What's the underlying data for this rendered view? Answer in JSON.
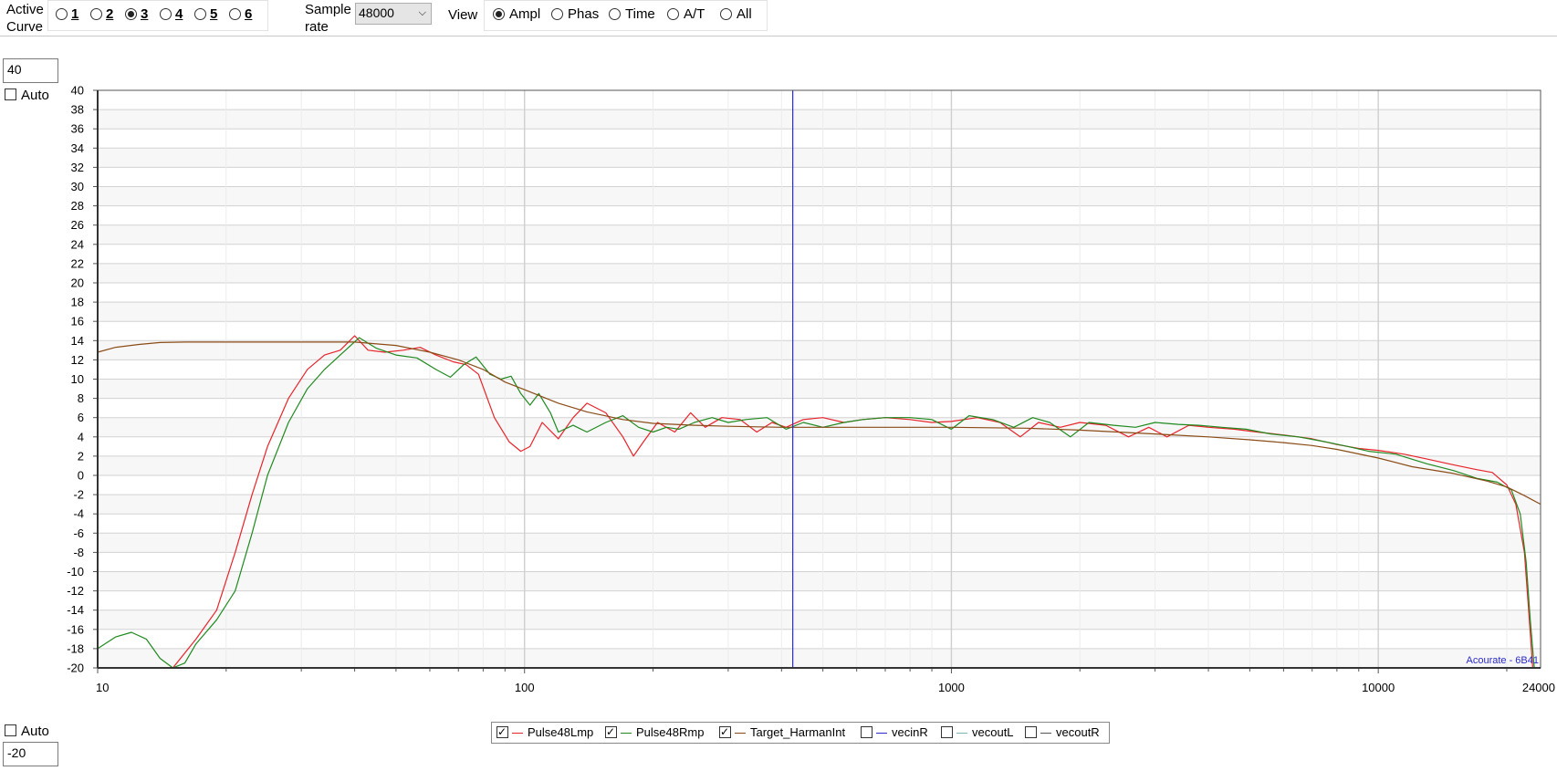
{
  "toolbar": {
    "active_curve_label": [
      "Active",
      "Curve"
    ],
    "curves": [
      {
        "label": "1",
        "selected": false
      },
      {
        "label": "2",
        "selected": false
      },
      {
        "label": "3",
        "selected": true
      },
      {
        "label": "4",
        "selected": false
      },
      {
        "label": "5",
        "selected": false
      },
      {
        "label": "6",
        "selected": false
      }
    ],
    "sample_rate_label": [
      "Sample",
      "rate"
    ],
    "sample_rate_value": "48000",
    "view_label": "View",
    "views": [
      {
        "label": "Ampl",
        "selected": true
      },
      {
        "label": "Phas",
        "selected": false
      },
      {
        "label": "Time",
        "selected": false
      },
      {
        "label": "A/T",
        "selected": false
      },
      {
        "label": "All",
        "selected": false
      }
    ]
  },
  "ymax_input": "40",
  "ymin_input": "-20",
  "auto_top_label": "Auto",
  "auto_bottom_label": "Auto",
  "auto_top_checked": false,
  "auto_bottom_checked": false,
  "watermark": "Acourate - 6B41",
  "colors": {
    "red": "#e8232a",
    "green": "#1f8a1f",
    "brown": "#8a4b16",
    "marker": "#2a2acc",
    "grid": "#d2d2d2"
  },
  "chart_data": {
    "type": "line",
    "x_scale": "log",
    "xlim": [
      10,
      24000
    ],
    "ylim": [
      -20,
      40
    ],
    "x_tick_labels": [
      "10",
      "100",
      "1000",
      "10000",
      "24000"
    ],
    "y_tick_labels": [
      "40",
      "38",
      "36",
      "34",
      "32",
      "30",
      "28",
      "26",
      "24",
      "22",
      "20",
      "18",
      "16",
      "14",
      "12",
      "10",
      "8",
      "6",
      "4",
      "2",
      "0",
      "-2",
      "-4",
      "-6",
      "-8",
      "-10",
      "-12",
      "-14",
      "-16",
      "-18",
      "-20"
    ],
    "marker_x": 425,
    "series": [
      {
        "name": "Pulse48Lmp",
        "color": "#e8232a",
        "checked": true,
        "points": [
          [
            15,
            -20
          ],
          [
            17,
            -17
          ],
          [
            19,
            -14
          ],
          [
            21,
            -8
          ],
          [
            23,
            -2
          ],
          [
            25,
            3
          ],
          [
            28,
            8
          ],
          [
            31,
            11
          ],
          [
            34,
            12.5
          ],
          [
            37,
            13
          ],
          [
            40,
            14.5
          ],
          [
            43,
            13
          ],
          [
            47,
            12.8
          ],
          [
            52,
            13
          ],
          [
            57,
            13.3
          ],
          [
            62,
            12.5
          ],
          [
            68,
            11.8
          ],
          [
            73,
            11.5
          ],
          [
            78,
            10.5
          ],
          [
            85,
            6
          ],
          [
            92,
            3.5
          ],
          [
            98,
            2.5
          ],
          [
            103,
            3
          ],
          [
            110,
            5.5
          ],
          [
            120,
            3.8
          ],
          [
            130,
            6
          ],
          [
            140,
            7.5
          ],
          [
            155,
            6.5
          ],
          [
            170,
            4
          ],
          [
            180,
            2
          ],
          [
            190,
            3.5
          ],
          [
            205,
            5.5
          ],
          [
            225,
            4.5
          ],
          [
            245,
            6.5
          ],
          [
            265,
            5
          ],
          [
            290,
            6
          ],
          [
            320,
            5.8
          ],
          [
            350,
            4.5
          ],
          [
            380,
            5.5
          ],
          [
            410,
            5
          ],
          [
            450,
            5.8
          ],
          [
            500,
            6
          ],
          [
            560,
            5.5
          ],
          [
            620,
            5.8
          ],
          [
            700,
            6
          ],
          [
            800,
            5.8
          ],
          [
            900,
            5.5
          ],
          [
            1000,
            5.6
          ],
          [
            1150,
            6
          ],
          [
            1300,
            5.5
          ],
          [
            1450,
            4
          ],
          [
            1600,
            5.5
          ],
          [
            1800,
            5
          ],
          [
            2000,
            5.5
          ],
          [
            2300,
            5.2
          ],
          [
            2600,
            4
          ],
          [
            2900,
            5
          ],
          [
            3200,
            4
          ],
          [
            3600,
            5.2
          ],
          [
            4000,
            5
          ],
          [
            4600,
            4.8
          ],
          [
            5200,
            4.5
          ],
          [
            6000,
            4.2
          ],
          [
            7000,
            3.8
          ],
          [
            8000,
            3.2
          ],
          [
            9000,
            2.8
          ],
          [
            10000,
            2.6
          ],
          [
            11500,
            2.2
          ],
          [
            13000,
            1.7
          ],
          [
            15000,
            1.1
          ],
          [
            17000,
            0.6
          ],
          [
            18500,
            0.3
          ],
          [
            20000,
            -1
          ],
          [
            21000,
            -3
          ],
          [
            22000,
            -8
          ],
          [
            22500,
            -14
          ],
          [
            23000,
            -20
          ]
        ]
      },
      {
        "name": "Pulse48Rmp",
        "color": "#1f8a1f",
        "checked": true,
        "points": [
          [
            10,
            -18
          ],
          [
            11,
            -16.8
          ],
          [
            12,
            -16.3
          ],
          [
            13,
            -17
          ],
          [
            14,
            -19
          ],
          [
            15,
            -20
          ],
          [
            16,
            -19.5
          ],
          [
            17,
            -17.5
          ],
          [
            19,
            -15
          ],
          [
            21,
            -12
          ],
          [
            23,
            -6
          ],
          [
            25,
            0
          ],
          [
            28,
            5.5
          ],
          [
            31,
            9
          ],
          [
            34,
            11
          ],
          [
            37,
            12.5
          ],
          [
            41,
            14.3
          ],
          [
            45,
            13.2
          ],
          [
            50,
            12.5
          ],
          [
            56,
            12.2
          ],
          [
            62,
            11
          ],
          [
            67,
            10.2
          ],
          [
            72,
            11.5
          ],
          [
            77,
            12.3
          ],
          [
            83,
            10.5
          ],
          [
            88,
            10
          ],
          [
            93,
            10.3
          ],
          [
            98,
            8.5
          ],
          [
            103,
            7.3
          ],
          [
            108,
            8.5
          ],
          [
            115,
            6.5
          ],
          [
            120,
            4.5
          ],
          [
            130,
            5.2
          ],
          [
            140,
            4.5
          ],
          [
            155,
            5.5
          ],
          [
            170,
            6.2
          ],
          [
            185,
            5
          ],
          [
            200,
            4.5
          ],
          [
            215,
            5
          ],
          [
            230,
            4.8
          ],
          [
            250,
            5.5
          ],
          [
            275,
            6
          ],
          [
            300,
            5.5
          ],
          [
            330,
            5.8
          ],
          [
            370,
            6
          ],
          [
            410,
            4.8
          ],
          [
            450,
            5.5
          ],
          [
            500,
            5
          ],
          [
            560,
            5.5
          ],
          [
            620,
            5.8
          ],
          [
            700,
            6
          ],
          [
            800,
            6
          ],
          [
            900,
            5.8
          ],
          [
            1000,
            4.8
          ],
          [
            1100,
            6.2
          ],
          [
            1250,
            5.8
          ],
          [
            1400,
            5
          ],
          [
            1550,
            6
          ],
          [
            1700,
            5.5
          ],
          [
            1900,
            4
          ],
          [
            2100,
            5.5
          ],
          [
            2400,
            5.2
          ],
          [
            2700,
            5
          ],
          [
            3000,
            5.5
          ],
          [
            3400,
            5.3
          ],
          [
            3800,
            5.2
          ],
          [
            4300,
            5
          ],
          [
            4900,
            4.8
          ],
          [
            5600,
            4.3
          ],
          [
            6500,
            4
          ],
          [
            7500,
            3.5
          ],
          [
            8500,
            3
          ],
          [
            9500,
            2.5
          ],
          [
            11000,
            2.2
          ],
          [
            13000,
            1.2
          ],
          [
            15000,
            0.5
          ],
          [
            17000,
            -0.3
          ],
          [
            19000,
            -0.7
          ],
          [
            20500,
            -1.5
          ],
          [
            21500,
            -4
          ],
          [
            22200,
            -9
          ],
          [
            22700,
            -15
          ],
          [
            23200,
            -20
          ]
        ]
      },
      {
        "name": "Target_HarmanInt",
        "color": "#8a4b16",
        "checked": true,
        "points": [
          [
            10,
            12.8
          ],
          [
            11,
            13.3
          ],
          [
            12.5,
            13.6
          ],
          [
            14,
            13.8
          ],
          [
            16,
            13.85
          ],
          [
            20,
            13.85
          ],
          [
            30,
            13.85
          ],
          [
            40,
            13.85
          ],
          [
            50,
            13.5
          ],
          [
            60,
            12.8
          ],
          [
            70,
            12
          ],
          [
            80,
            11
          ],
          [
            90,
            9.7
          ],
          [
            100,
            8.9
          ],
          [
            120,
            7.5
          ],
          [
            140,
            6.6
          ],
          [
            170,
            5.8
          ],
          [
            200,
            5.4
          ],
          [
            250,
            5.2
          ],
          [
            300,
            5.1
          ],
          [
            400,
            5
          ],
          [
            500,
            5
          ],
          [
            700,
            5
          ],
          [
            1000,
            5
          ],
          [
            1500,
            4.9
          ],
          [
            2000,
            4.7
          ],
          [
            3000,
            4.3
          ],
          [
            4000,
            4
          ],
          [
            5000,
            3.7
          ],
          [
            6000,
            3.4
          ],
          [
            7000,
            3.1
          ],
          [
            8000,
            2.7
          ],
          [
            10000,
            1.8
          ],
          [
            12000,
            0.9
          ],
          [
            15000,
            0.2
          ],
          [
            18000,
            -0.6
          ],
          [
            20000,
            -1.2
          ],
          [
            22000,
            -2.1
          ],
          [
            24000,
            -3
          ]
        ]
      },
      {
        "name": "vecinR",
        "color": "#2a2acc",
        "checked": false,
        "points": []
      },
      {
        "name": "vecoutL",
        "color": "#7fb2b2",
        "checked": false,
        "points": []
      },
      {
        "name": "vecoutR",
        "color": "#555555",
        "checked": false,
        "points": []
      }
    ]
  }
}
